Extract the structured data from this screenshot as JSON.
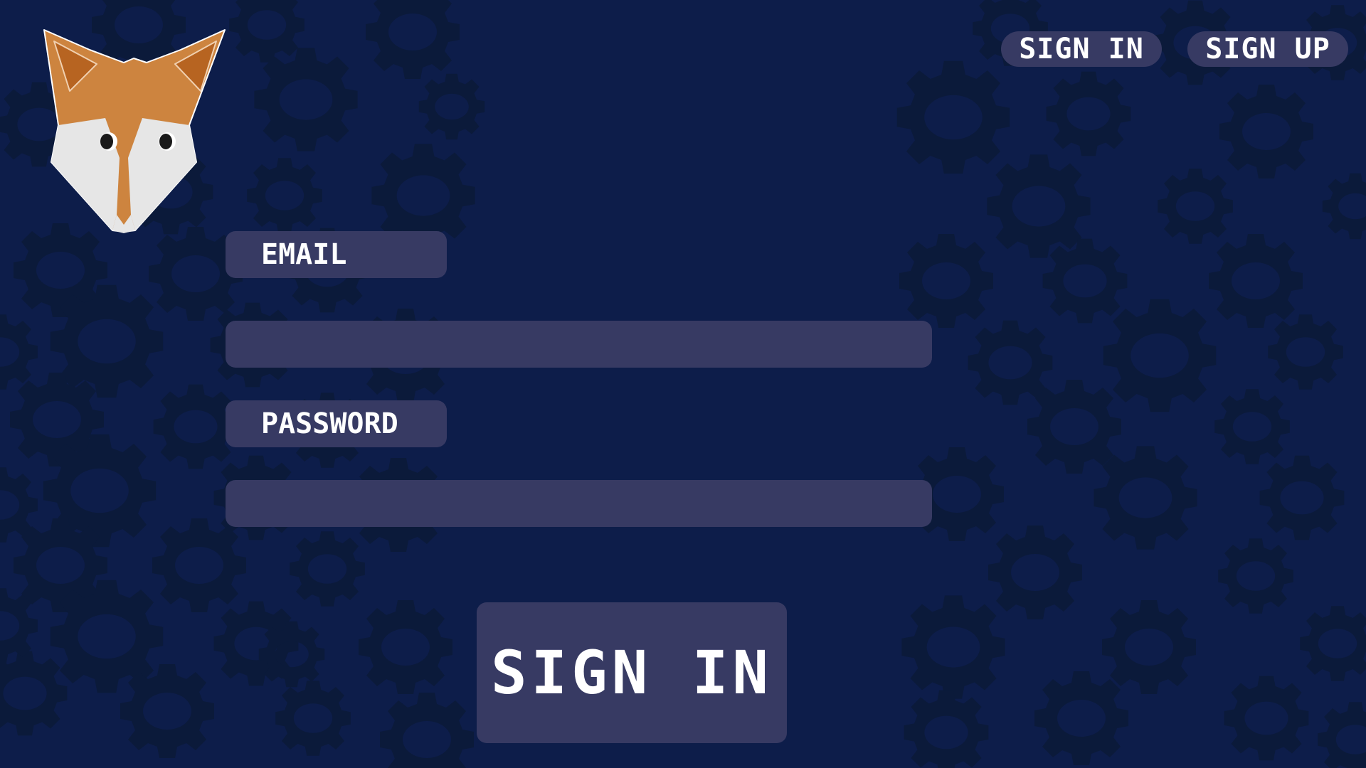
{
  "header": {
    "nav": {
      "sign_in_label": "SIGN IN",
      "sign_up_label": "SIGN UP"
    }
  },
  "form": {
    "email_label": "EMAIL",
    "email_value": "",
    "password_label": "PASSWORD",
    "password_value": "",
    "submit_label": "SIGN IN"
  },
  "icons": {
    "logo": "fox-head-logo",
    "background": "gear-pattern"
  },
  "colors": {
    "background": "#0d1d4a",
    "gear": "#0b1a3a",
    "panel": "#373a63",
    "text": "#ffffff",
    "fox_orange": "#cd843f",
    "fox_ear": "#b76421",
    "fox_white": "#e6e6e6"
  }
}
